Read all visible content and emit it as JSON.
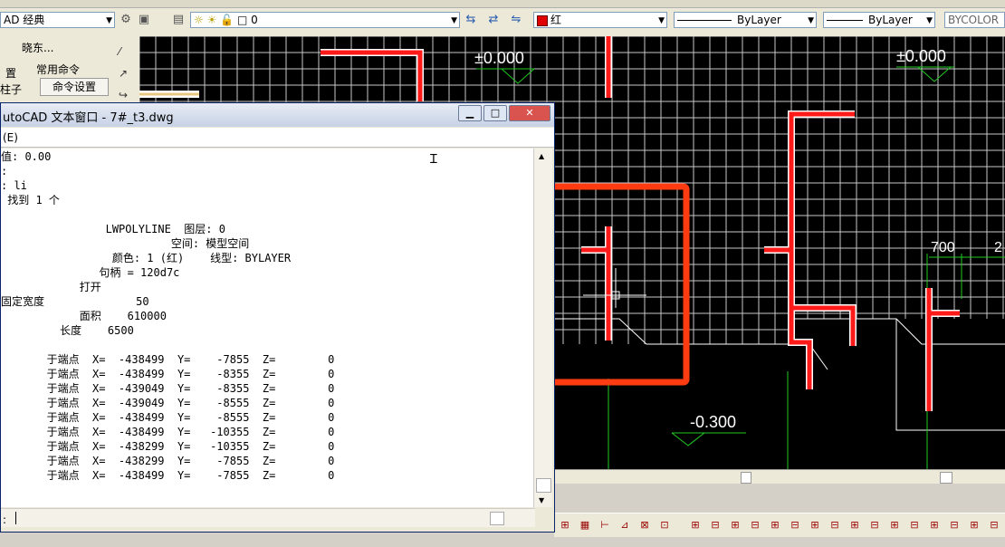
{
  "toolbar": {
    "workspace": "AD 经典",
    "layer": "0",
    "color": "红",
    "linetype": "ByLayer",
    "lineweight": "ByLayer",
    "plotstyle": "BYCOLOR"
  },
  "palette": {
    "title": "晓东...",
    "header": "常用命令",
    "button": "命令设置",
    "side1": "置",
    "side2": "柱子"
  },
  "drawing": {
    "elev1": "±0.000",
    "elev2": "±0.000",
    "elev3": "-0.300",
    "dim1": "700",
    "dim2": "2"
  },
  "textwin": {
    "title": "utoCAD 文本窗口 - 7#_t3.dwg",
    "menu": "(E)",
    "lines": [
      "值: 0.00",
      ":",
      ": li",
      " 找到 1 个",
      "",
      "                LWPOLYLINE  图层: 0",
      "                          空间: 模型空间",
      "                 颜色: 1 (红)    线型: BYLAYER",
      "               句柄 = 120d7c",
      "            打开",
      "固定宽度              50",
      "            面积    610000",
      "         长度    6500",
      "",
      "       于端点  X=  -438499  Y=    -7855  Z=        0",
      "       于端点  X=  -438499  Y=    -8355  Z=        0",
      "       于端点  X=  -439049  Y=    -8355  Z=        0",
      "       于端点  X=  -439049  Y=    -8555  Z=        0",
      "       于端点  X=  -438499  Y=    -8555  Z=        0",
      "       于端点  X=  -438499  Y=   -10355  Z=        0",
      "       于端点  X=  -438299  Y=   -10355  Z=        0",
      "       于端点  X=  -438299  Y=    -7855  Z=        0",
      "       于端点  X=  -438499  Y=    -7855  Z=        0"
    ],
    "prompt": ":"
  }
}
